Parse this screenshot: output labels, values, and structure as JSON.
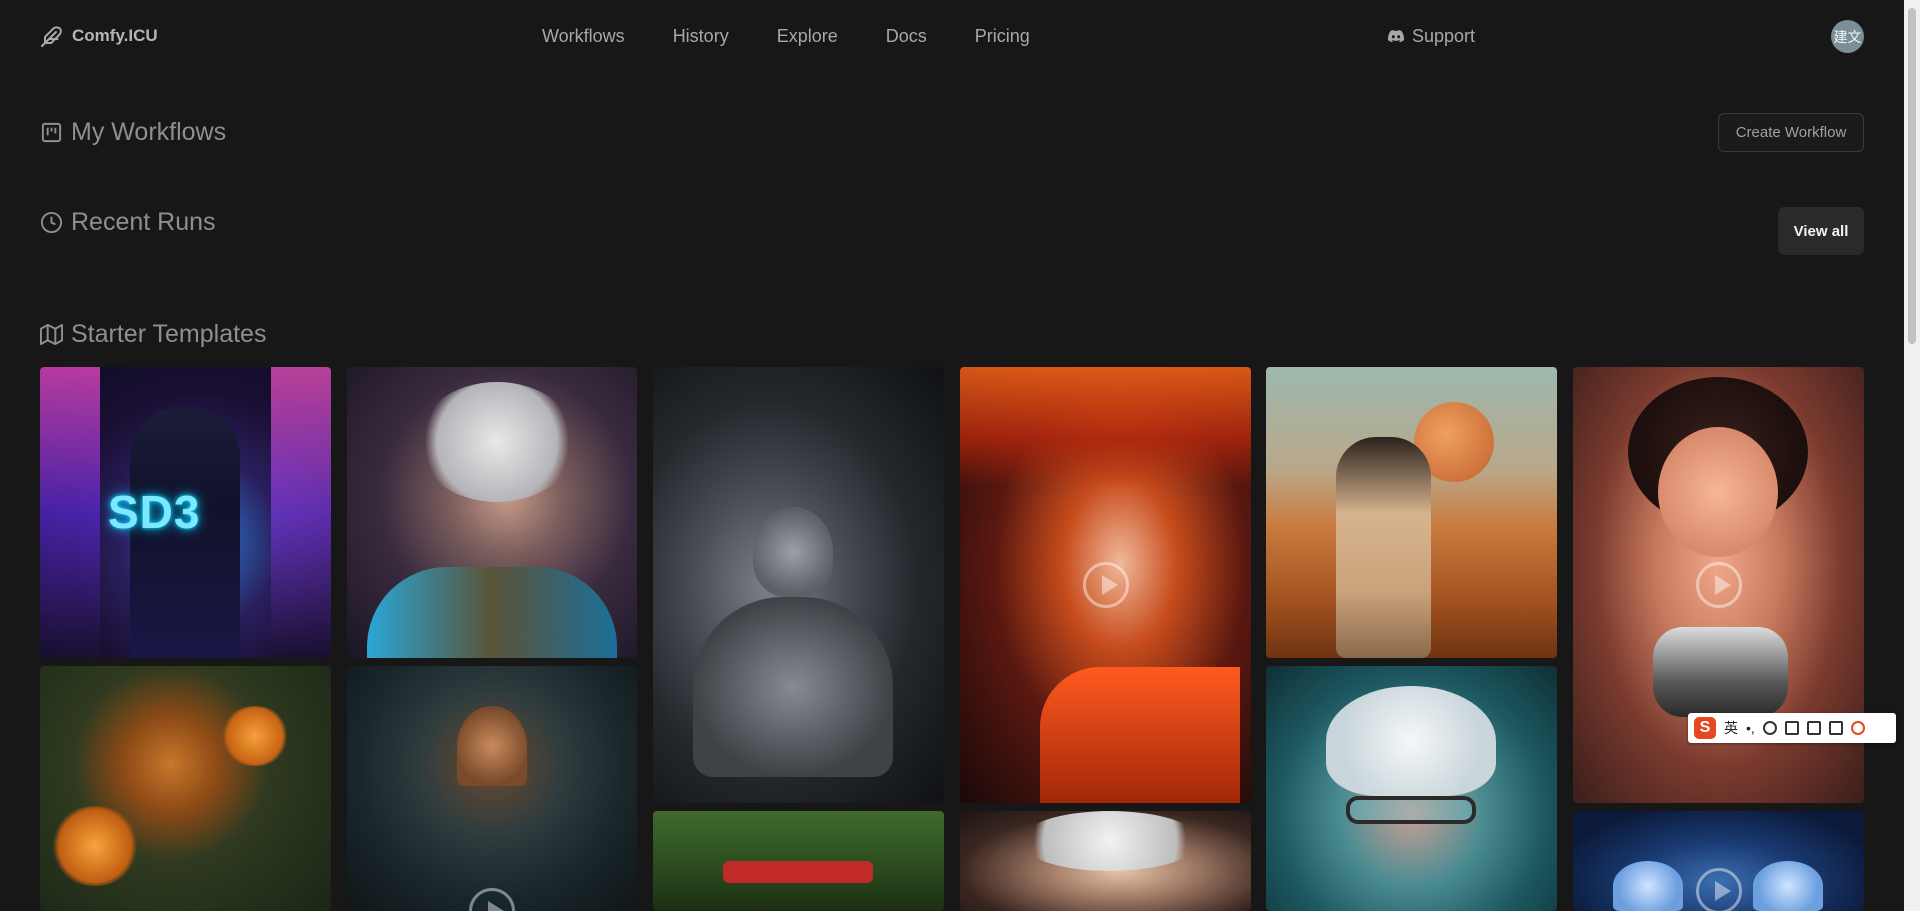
{
  "header": {
    "logo_text": "Comfy.ICU",
    "nav": [
      "Workflows",
      "History",
      "Explore",
      "Docs",
      "Pricing"
    ],
    "support_label": "Support",
    "avatar_text": "建文"
  },
  "sections": {
    "my_workflows": {
      "title": "My Workflows",
      "button": "Create Workflow"
    },
    "recent_runs": {
      "title": "Recent Runs",
      "button": "View all"
    },
    "starter_templates": {
      "title": "Starter Templates"
    }
  },
  "tiles": [
    {
      "name": "tile-neon-girl-sd3",
      "text": "SD3",
      "video": false
    },
    {
      "name": "tile-einstein-portrait",
      "video": false
    },
    {
      "name": "tile-stone-buddha",
      "video": false
    },
    {
      "name": "tile-anime-girl-flames",
      "video": true
    },
    {
      "name": "tile-mars-astronaut",
      "video": false
    },
    {
      "name": "tile-cartoon-woman",
      "video": true
    },
    {
      "name": "tile-tiger-lilies",
      "video": false
    },
    {
      "name": "tile-dragon-queen",
      "video": true
    },
    {
      "name": "tile-headband-man",
      "video": false
    },
    {
      "name": "tile-elder-face",
      "video": false
    },
    {
      "name": "tile-white-hair-glasses",
      "video": false
    },
    {
      "name": "tile-jellyfish",
      "video": true
    }
  ],
  "ime": {
    "mode": "英",
    "logo": "S"
  },
  "colors": {
    "background": "#171717",
    "text": "#a3a3a3",
    "button_solid": "#2a2a2a"
  }
}
